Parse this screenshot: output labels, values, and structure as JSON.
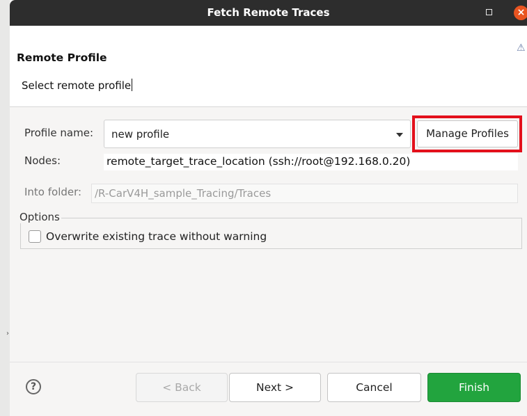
{
  "window": {
    "title": "Fetch Remote Traces",
    "maximize_icon": "square-icon",
    "close_icon": "close-icon",
    "close_glyph": "×"
  },
  "header": {
    "title": "Remote Profile",
    "description": "Select remote profile",
    "wizard_icon": "wizard-icon"
  },
  "form": {
    "profile_label": "Profile name:",
    "profile_value": "new profile",
    "manage_button": "Manage Profiles",
    "nodes_label": "Nodes:",
    "nodes_value": "remote_target_trace_location (ssh://root@192.168.0.20)",
    "folder_label": "Into folder:",
    "folder_value": "/R-CarV4H_sample_Tracing/Traces"
  },
  "options": {
    "legend": "Options",
    "overwrite_label": "Overwrite existing trace without warning",
    "overwrite_checked": false
  },
  "footer": {
    "help_glyph": "?",
    "back": "< Back",
    "next": "Next >",
    "cancel": "Cancel",
    "finish": "Finish"
  },
  "colors": {
    "titlebar": "#2d2d2d",
    "close": "#e95420",
    "finish": "#22a43e",
    "highlight": "#e3101b"
  }
}
